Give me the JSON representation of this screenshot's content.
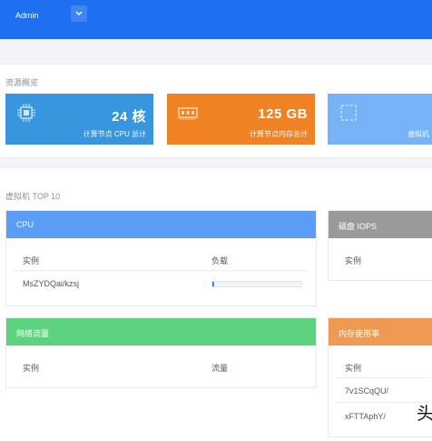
{
  "topbar": {
    "user": "Admin",
    "dropdown_icon": "chevron-down-icon",
    "color": "#1e70f0"
  },
  "resources": {
    "title": "资源概览",
    "cards": [
      {
        "value": "24 核",
        "label": "计算节点 CPU 总计",
        "icon": "cpu-icon",
        "color": "#3896de"
      },
      {
        "value": "125 GB",
        "label": "计算节点内存总计",
        "icon": "memory-icon",
        "color": "#ef8324"
      },
      {
        "value": "",
        "label": "虚拟机",
        "icon": "storage-icon",
        "color": "#76b3f7"
      }
    ]
  },
  "vm_top": {
    "title": "虚拟机 TOP 10",
    "cpu": {
      "title": "CPU",
      "col_instance": "实例",
      "col_load": "负载",
      "rows": [
        {
          "instance": "MsZYDQai/kzsj",
          "load": 0.02
        }
      ]
    },
    "iops": {
      "title": "磁盘 IOPS",
      "col_instance": "实例"
    },
    "network": {
      "title": "网络流量",
      "col_instance": "实例",
      "col_traffic": "流量"
    },
    "memory": {
      "title": "内存使用率",
      "col_instance": "实例",
      "rows": [
        {
          "instance": "7v1SCqQU/"
        },
        {
          "instance": "xFTTAphY/"
        }
      ]
    }
  },
  "overlay": {
    "char": "头"
  }
}
